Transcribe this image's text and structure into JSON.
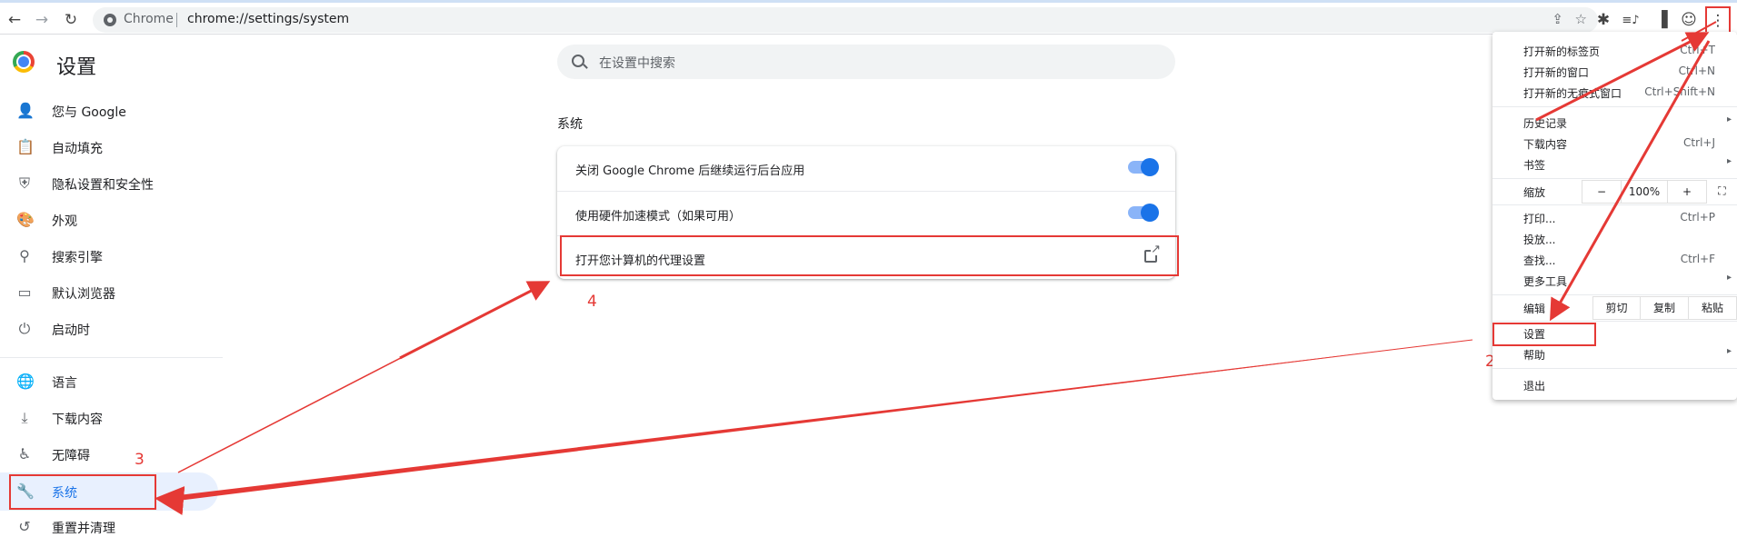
{
  "toolbar": {
    "back": "←",
    "forward": "→",
    "reload": "↻",
    "omnibox_label": "Chrome",
    "url": "chrome://settings/system",
    "share_icon": "⇪",
    "star_icon": "☆",
    "extensions_icon": "✱",
    "media_icon": "≡♪",
    "sidepanel_icon": "▐",
    "profile_icon": "☺",
    "menu_icon": "⋮"
  },
  "page": {
    "title": "设置",
    "search_placeholder": "在设置中搜索"
  },
  "sidebar": {
    "items": [
      {
        "label": "您与 Google",
        "icon": "person-icon",
        "glyph": "👤"
      },
      {
        "label": "自动填充",
        "icon": "clipboard-icon",
        "glyph": "📋"
      },
      {
        "label": "隐私设置和安全性",
        "icon": "shield-icon",
        "glyph": "⛨"
      },
      {
        "label": "外观",
        "icon": "palette-icon",
        "glyph": "🎨"
      },
      {
        "label": "搜索引擎",
        "icon": "search-icon",
        "glyph": "⚲"
      },
      {
        "label": "默认浏览器",
        "icon": "browser-icon",
        "glyph": "▭"
      },
      {
        "label": "启动时",
        "icon": "power-icon",
        "glyph": "⏻"
      },
      {
        "label": "语言",
        "icon": "globe-icon",
        "glyph": "🌐"
      },
      {
        "label": "下载内容",
        "icon": "download-icon",
        "glyph": "⤓"
      },
      {
        "label": "无障碍",
        "icon": "accessibility-icon",
        "glyph": "♿"
      },
      {
        "label": "系统",
        "icon": "wrench-icon",
        "glyph": "🔧"
      },
      {
        "label": "重置并清理",
        "icon": "reset-icon",
        "glyph": "↺"
      }
    ]
  },
  "main": {
    "section_title": "系统",
    "rows": [
      {
        "label": "关闭 Google Chrome 后继续运行后台应用",
        "control": "toggle",
        "on": true
      },
      {
        "label": "使用硬件加速模式（如果可用）",
        "control": "toggle",
        "on": true
      },
      {
        "label": "打开您计算机的代理设置",
        "control": "external-link"
      }
    ]
  },
  "annotations": {
    "step2": "2",
    "step3": "3",
    "step4": "4",
    "color": "#e53935"
  },
  "menu": {
    "items": [
      {
        "label": "打开新的标签页",
        "shortcut": "Ctrl+T"
      },
      {
        "label": "打开新的窗口",
        "shortcut": "Ctrl+N"
      },
      {
        "label": "打开新的无痕式窗口",
        "shortcut": "Ctrl+Shift+N"
      },
      {
        "label": "历史记录",
        "shortcut": "",
        "submenu": true
      },
      {
        "label": "下载内容",
        "shortcut": "Ctrl+J"
      },
      {
        "label": "书签",
        "shortcut": "",
        "submenu": true
      },
      {
        "label": "打印...",
        "shortcut": "Ctrl+P"
      },
      {
        "label": "投放...",
        "shortcut": ""
      },
      {
        "label": "查找...",
        "shortcut": "Ctrl+F"
      },
      {
        "label": "更多工具",
        "shortcut": "",
        "submenu": true
      },
      {
        "label": "设置",
        "shortcut": ""
      },
      {
        "label": "帮助",
        "shortcut": "",
        "submenu": true
      },
      {
        "label": "退出",
        "shortcut": ""
      }
    ],
    "zoom": {
      "label": "缩放",
      "minus": "−",
      "value": "100%",
      "plus": "+",
      "fullscreen": "⛶"
    },
    "edit": {
      "label": "编辑",
      "cut": "剪切",
      "copy": "复制",
      "paste": "粘贴"
    }
  },
  "colors": {
    "accent": "#1a73e8",
    "annotation": "#e53935",
    "active_bg": "#e8f0fe"
  }
}
